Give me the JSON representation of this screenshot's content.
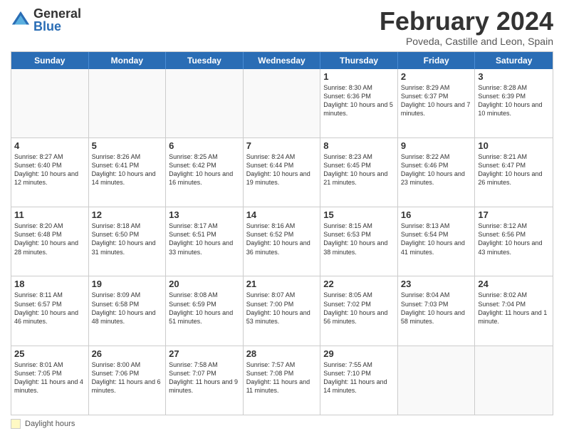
{
  "logo": {
    "general": "General",
    "blue": "Blue"
  },
  "title": "February 2024",
  "location": "Poveda, Castille and Leon, Spain",
  "days_of_week": [
    "Sunday",
    "Monday",
    "Tuesday",
    "Wednesday",
    "Thursday",
    "Friday",
    "Saturday"
  ],
  "legend_label": "Daylight hours",
  "weeks": [
    [
      {
        "day": "",
        "info": ""
      },
      {
        "day": "",
        "info": ""
      },
      {
        "day": "",
        "info": ""
      },
      {
        "day": "",
        "info": ""
      },
      {
        "day": "1",
        "info": "Sunrise: 8:30 AM\nSunset: 6:36 PM\nDaylight: 10 hours\nand 5 minutes."
      },
      {
        "day": "2",
        "info": "Sunrise: 8:29 AM\nSunset: 6:37 PM\nDaylight: 10 hours\nand 7 minutes."
      },
      {
        "day": "3",
        "info": "Sunrise: 8:28 AM\nSunset: 6:39 PM\nDaylight: 10 hours\nand 10 minutes."
      }
    ],
    [
      {
        "day": "4",
        "info": "Sunrise: 8:27 AM\nSunset: 6:40 PM\nDaylight: 10 hours\nand 12 minutes."
      },
      {
        "day": "5",
        "info": "Sunrise: 8:26 AM\nSunset: 6:41 PM\nDaylight: 10 hours\nand 14 minutes."
      },
      {
        "day": "6",
        "info": "Sunrise: 8:25 AM\nSunset: 6:42 PM\nDaylight: 10 hours\nand 16 minutes."
      },
      {
        "day": "7",
        "info": "Sunrise: 8:24 AM\nSunset: 6:44 PM\nDaylight: 10 hours\nand 19 minutes."
      },
      {
        "day": "8",
        "info": "Sunrise: 8:23 AM\nSunset: 6:45 PM\nDaylight: 10 hours\nand 21 minutes."
      },
      {
        "day": "9",
        "info": "Sunrise: 8:22 AM\nSunset: 6:46 PM\nDaylight: 10 hours\nand 23 minutes."
      },
      {
        "day": "10",
        "info": "Sunrise: 8:21 AM\nSunset: 6:47 PM\nDaylight: 10 hours\nand 26 minutes."
      }
    ],
    [
      {
        "day": "11",
        "info": "Sunrise: 8:20 AM\nSunset: 6:48 PM\nDaylight: 10 hours\nand 28 minutes."
      },
      {
        "day": "12",
        "info": "Sunrise: 8:18 AM\nSunset: 6:50 PM\nDaylight: 10 hours\nand 31 minutes."
      },
      {
        "day": "13",
        "info": "Sunrise: 8:17 AM\nSunset: 6:51 PM\nDaylight: 10 hours\nand 33 minutes."
      },
      {
        "day": "14",
        "info": "Sunrise: 8:16 AM\nSunset: 6:52 PM\nDaylight: 10 hours\nand 36 minutes."
      },
      {
        "day": "15",
        "info": "Sunrise: 8:15 AM\nSunset: 6:53 PM\nDaylight: 10 hours\nand 38 minutes."
      },
      {
        "day": "16",
        "info": "Sunrise: 8:13 AM\nSunset: 6:54 PM\nDaylight: 10 hours\nand 41 minutes."
      },
      {
        "day": "17",
        "info": "Sunrise: 8:12 AM\nSunset: 6:56 PM\nDaylight: 10 hours\nand 43 minutes."
      }
    ],
    [
      {
        "day": "18",
        "info": "Sunrise: 8:11 AM\nSunset: 6:57 PM\nDaylight: 10 hours\nand 46 minutes."
      },
      {
        "day": "19",
        "info": "Sunrise: 8:09 AM\nSunset: 6:58 PM\nDaylight: 10 hours\nand 48 minutes."
      },
      {
        "day": "20",
        "info": "Sunrise: 8:08 AM\nSunset: 6:59 PM\nDaylight: 10 hours\nand 51 minutes."
      },
      {
        "day": "21",
        "info": "Sunrise: 8:07 AM\nSunset: 7:00 PM\nDaylight: 10 hours\nand 53 minutes."
      },
      {
        "day": "22",
        "info": "Sunrise: 8:05 AM\nSunset: 7:02 PM\nDaylight: 10 hours\nand 56 minutes."
      },
      {
        "day": "23",
        "info": "Sunrise: 8:04 AM\nSunset: 7:03 PM\nDaylight: 10 hours\nand 58 minutes."
      },
      {
        "day": "24",
        "info": "Sunrise: 8:02 AM\nSunset: 7:04 PM\nDaylight: 11 hours\nand 1 minute."
      }
    ],
    [
      {
        "day": "25",
        "info": "Sunrise: 8:01 AM\nSunset: 7:05 PM\nDaylight: 11 hours\nand 4 minutes."
      },
      {
        "day": "26",
        "info": "Sunrise: 8:00 AM\nSunset: 7:06 PM\nDaylight: 11 hours\nand 6 minutes."
      },
      {
        "day": "27",
        "info": "Sunrise: 7:58 AM\nSunset: 7:07 PM\nDaylight: 11 hours\nand 9 minutes."
      },
      {
        "day": "28",
        "info": "Sunrise: 7:57 AM\nSunset: 7:08 PM\nDaylight: 11 hours\nand 11 minutes."
      },
      {
        "day": "29",
        "info": "Sunrise: 7:55 AM\nSunset: 7:10 PM\nDaylight: 11 hours\nand 14 minutes."
      },
      {
        "day": "",
        "info": ""
      },
      {
        "day": "",
        "info": ""
      }
    ]
  ]
}
